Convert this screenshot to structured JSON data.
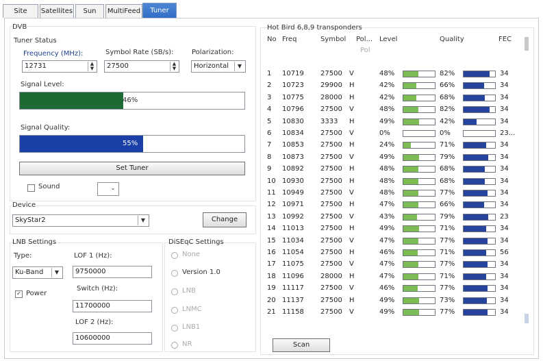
{
  "tabs": [
    {
      "label": "Site"
    },
    {
      "label": "Satellites"
    },
    {
      "label": "Sun"
    },
    {
      "label": "MultiFeed"
    },
    {
      "label": "Tuner"
    }
  ],
  "dvb": {
    "group_label": "DVB",
    "tuner_status_label": "Tuner Status",
    "frequency_label": "Frequency (MHz):",
    "frequency_value": "12731",
    "symbol_rate_label": "Symbol Rate (SB/s):",
    "symbol_rate_value": "27500",
    "polarization_label": "Polarization:",
    "polarization_value": "Horizontal",
    "signal_level_label": "Signal Level:",
    "signal_level_text": "46%",
    "signal_level_fraction": 0.46,
    "signal_level_color": "#1e6a35",
    "signal_quality_label": "Signal Quality:",
    "signal_quality_text": "55%",
    "signal_quality_fraction": 0.55,
    "signal_quality_color": "#1a3fa6",
    "set_tuner_label": "Set Tuner",
    "sound_label": "Sound"
  },
  "device": {
    "label": "Device",
    "value": "SkyStar2",
    "change_label": "Change"
  },
  "lnb": {
    "label": "LNB Settings",
    "type_label": "Type:",
    "type_value": "Ku-Band",
    "power_label": "Power",
    "lof1_label": "LOF 1 (Hz):",
    "lof1_value": "9750000",
    "switch_label": "Switch (Hz):",
    "switch_value": "11700000",
    "lof2_label": "LOF 2 (Hz):",
    "lof2_value": "10600000"
  },
  "diseqc": {
    "label": "DiSEqC Settings",
    "options": [
      "None",
      "Version 1.0",
      "LNB",
      "LNMC",
      "LNB1",
      "NR"
    ]
  },
  "transponders": {
    "title": "Hot Bird 6,8,9 transponders",
    "columns": {
      "no": "No",
      "freq": "Freq",
      "symbol": "Symbol",
      "pol": "Pol...",
      "level": "Level",
      "quality": "Quality",
      "fec": "FEC"
    },
    "pol_sub": "Pol",
    "level_color": "#7dbb55",
    "quality_color": "#27449c",
    "rows": [
      {
        "no": "1",
        "freq": "10719",
        "symbol": "27500",
        "pol": "V",
        "level": "48%",
        "lv": 0.48,
        "quality": "82%",
        "qv": 0.82,
        "fec": "34"
      },
      {
        "no": "2",
        "freq": "10723",
        "symbol": "29900",
        "pol": "H",
        "level": "42%",
        "lv": 0.42,
        "quality": "66%",
        "qv": 0.66,
        "fec": "34"
      },
      {
        "no": "3",
        "freq": "10775",
        "symbol": "28000",
        "pol": "H",
        "level": "42%",
        "lv": 0.42,
        "quality": "68%",
        "qv": 0.68,
        "fec": "34"
      },
      {
        "no": "4",
        "freq": "10796",
        "symbol": "27500",
        "pol": "V",
        "level": "48%",
        "lv": 0.48,
        "quality": "82%",
        "qv": 0.82,
        "fec": "34"
      },
      {
        "no": "5",
        "freq": "10830",
        "symbol": "3333",
        "pol": "H",
        "level": "49%",
        "lv": 0.49,
        "quality": "42%",
        "qv": 0.42,
        "fec": "34"
      },
      {
        "no": "6",
        "freq": "10834",
        "symbol": "27500",
        "pol": "V",
        "level": "0%",
        "lv": 0,
        "quality": "0%",
        "qv": 0,
        "fec": "23..."
      },
      {
        "no": "7",
        "freq": "10853",
        "symbol": "27500",
        "pol": "H",
        "level": "24%",
        "lv": 0.24,
        "quality": "71%",
        "qv": 0.71,
        "fec": "34"
      },
      {
        "no": "8",
        "freq": "10873",
        "symbol": "27500",
        "pol": "V",
        "level": "49%",
        "lv": 0.49,
        "quality": "79%",
        "qv": 0.79,
        "fec": "34"
      },
      {
        "no": "9",
        "freq": "10892",
        "symbol": "27500",
        "pol": "H",
        "level": "48%",
        "lv": 0.48,
        "quality": "68%",
        "qv": 0.68,
        "fec": "34"
      },
      {
        "no": "10",
        "freq": "10930",
        "symbol": "27500",
        "pol": "H",
        "level": "48%",
        "lv": 0.48,
        "quality": "68%",
        "qv": 0.68,
        "fec": "34"
      },
      {
        "no": "11",
        "freq": "10949",
        "symbol": "27500",
        "pol": "V",
        "level": "48%",
        "lv": 0.48,
        "quality": "77%",
        "qv": 0.77,
        "fec": "34"
      },
      {
        "no": "12",
        "freq": "10971",
        "symbol": "27500",
        "pol": "H",
        "level": "47%",
        "lv": 0.47,
        "quality": "66%",
        "qv": 0.66,
        "fec": "34"
      },
      {
        "no": "13",
        "freq": "10992",
        "symbol": "27500",
        "pol": "V",
        "level": "43%",
        "lv": 0.43,
        "quality": "79%",
        "qv": 0.79,
        "fec": "23"
      },
      {
        "no": "14",
        "freq": "11013",
        "symbol": "27500",
        "pol": "H",
        "level": "49%",
        "lv": 0.49,
        "quality": "71%",
        "qv": 0.71,
        "fec": "34"
      },
      {
        "no": "15",
        "freq": "11034",
        "symbol": "27500",
        "pol": "V",
        "level": "47%",
        "lv": 0.47,
        "quality": "77%",
        "qv": 0.77,
        "fec": "34"
      },
      {
        "no": "16",
        "freq": "11054",
        "symbol": "27500",
        "pol": "H",
        "level": "46%",
        "lv": 0.46,
        "quality": "71%",
        "qv": 0.71,
        "fec": "56"
      },
      {
        "no": "17",
        "freq": "11075",
        "symbol": "27500",
        "pol": "V",
        "level": "47%",
        "lv": 0.47,
        "quality": "77%",
        "qv": 0.77,
        "fec": "34"
      },
      {
        "no": "18",
        "freq": "11096",
        "symbol": "28000",
        "pol": "H",
        "level": "47%",
        "lv": 0.47,
        "quality": "71%",
        "qv": 0.71,
        "fec": "34"
      },
      {
        "no": "19",
        "freq": "11117",
        "symbol": "27500",
        "pol": "V",
        "level": "46%",
        "lv": 0.46,
        "quality": "77%",
        "qv": 0.77,
        "fec": "34"
      },
      {
        "no": "20",
        "freq": "11137",
        "symbol": "27500",
        "pol": "H",
        "level": "49%",
        "lv": 0.49,
        "quality": "73%",
        "qv": 0.73,
        "fec": "34"
      },
      {
        "no": "21",
        "freq": "11158",
        "symbol": "27500",
        "pol": "V",
        "level": "49%",
        "lv": 0.49,
        "quality": "77%",
        "qv": 0.77,
        "fec": "34"
      }
    ],
    "scan_label": "Scan"
  }
}
